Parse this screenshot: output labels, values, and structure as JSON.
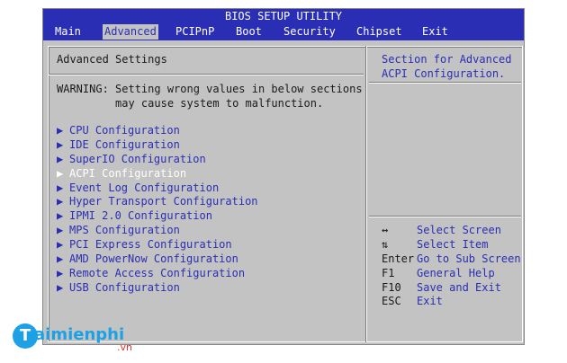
{
  "title": "BIOS SETUP UTILITY",
  "menu": [
    {
      "label": "Main",
      "active": false
    },
    {
      "label": "Advanced",
      "active": true
    },
    {
      "label": "PCIPnP",
      "active": false
    },
    {
      "label": "Boot",
      "active": false
    },
    {
      "label": "Security",
      "active": false
    },
    {
      "label": "Chipset",
      "active": false
    },
    {
      "label": "Exit",
      "active": false
    }
  ],
  "left_panel": {
    "heading": "Advanced Settings",
    "warning_line1": "WARNING: Setting wrong values in below sections",
    "warning_line2": "         may cause system to malfunction.",
    "items": [
      {
        "label": "CPU Configuration",
        "selected": false
      },
      {
        "label": "IDE Configuration",
        "selected": false
      },
      {
        "label": "SuperIO Configuration",
        "selected": false
      },
      {
        "label": "ACPI Configuration",
        "selected": true
      },
      {
        "label": "Event Log Configuration",
        "selected": false
      },
      {
        "label": "Hyper Transport Configuration",
        "selected": false
      },
      {
        "label": "IPMI 2.0 Configuration",
        "selected": false
      },
      {
        "label": "MPS Configuration",
        "selected": false
      },
      {
        "label": "PCI Express Configuration",
        "selected": false
      },
      {
        "label": "AMD PowerNow Configuration",
        "selected": false
      },
      {
        "label": "Remote Access Configuration",
        "selected": false
      },
      {
        "label": "USB Configuration",
        "selected": false
      }
    ],
    "arrow_glyph": "▶"
  },
  "right_panel": {
    "help_line1": "Section for Advanced",
    "help_line2": "ACPI Configuration.",
    "keys": [
      {
        "key": "↔",
        "desc": "Select Screen"
      },
      {
        "key": "⇅",
        "desc": "Select Item"
      },
      {
        "key": "Enter",
        "desc": "Go to Sub Screen"
      },
      {
        "key": "F1",
        "desc": "General Help"
      },
      {
        "key": "F10",
        "desc": "Save and Exit"
      },
      {
        "key": "ESC",
        "desc": "Exit"
      }
    ]
  },
  "watermark": {
    "initial": "T",
    "text": "aimienphi",
    "suffix": ".vn"
  },
  "colors": {
    "bios_blue": "#2a2eb4",
    "bios_gray": "#c3c3c3",
    "selected_text": "#ffffff",
    "watermark_blue": "#1ea1e4",
    "watermark_red": "#e0322d"
  }
}
